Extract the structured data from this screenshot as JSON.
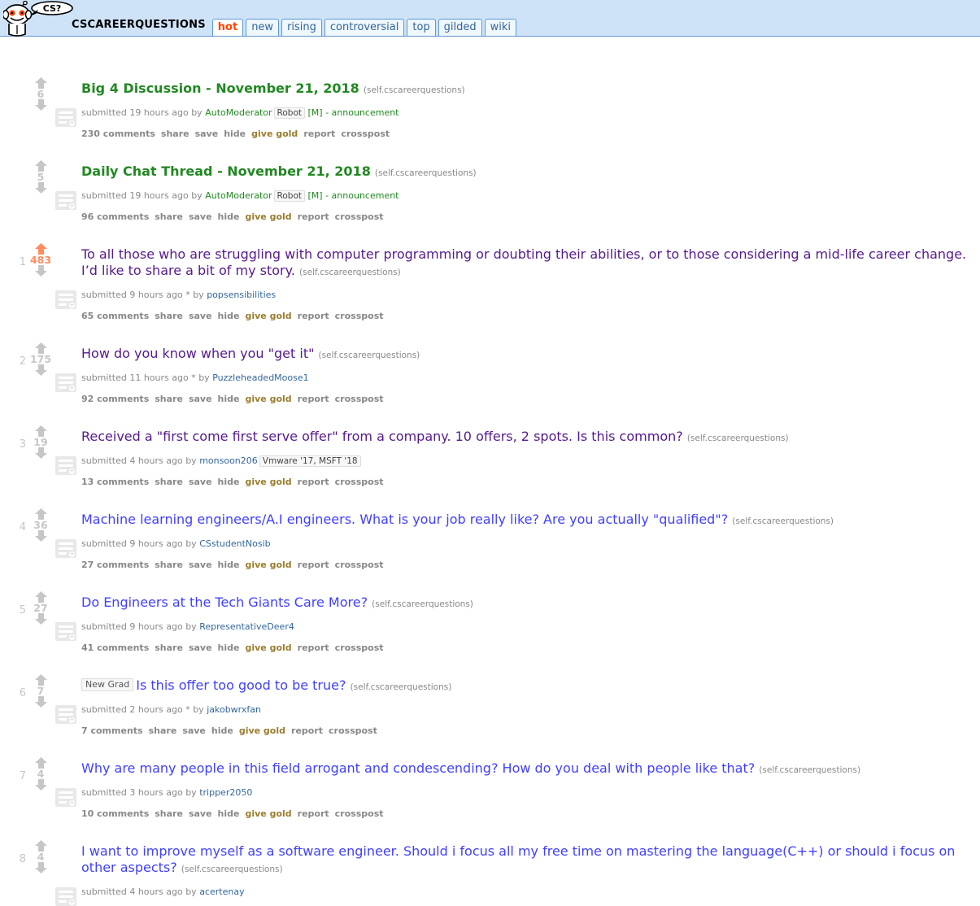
{
  "header": {
    "logo_icon": "reddit-alien-logo",
    "logo_speech_text": "CS?",
    "subreddit": "CSCAREERQUESTIONS",
    "tabs": [
      {
        "label": "hot",
        "selected": true
      },
      {
        "label": "new",
        "selected": false
      },
      {
        "label": "rising",
        "selected": false
      },
      {
        "label": "controversial",
        "selected": false
      },
      {
        "label": "top",
        "selected": false
      },
      {
        "label": "gilded",
        "selected": false
      },
      {
        "label": "wiki",
        "selected": false
      }
    ]
  },
  "colors": {
    "header_bg": "#cee3f8",
    "header_border": "#5f99cf",
    "tab_selected_text": "#ff4500",
    "tab_text": "#336699",
    "link_unvisited": "#4040ff",
    "link_visited": "#551a8b",
    "sticky_title": "#228822",
    "upvoted": "#ff8b60",
    "score_grey": "#c6c6c6",
    "meta_grey": "#888888",
    "gold_link": "#9a7d2e"
  },
  "buttons_labels": {
    "share": "share",
    "save": "save",
    "hide": "hide",
    "give_gold": "give gold",
    "report": "report",
    "crosspost": "crosspost"
  },
  "posts": [
    {
      "rank": "",
      "score": "6",
      "upvoted": false,
      "sticky": true,
      "visited": false,
      "link_flair": "",
      "title": "Big 4 Discussion - November 21, 2018",
      "domain": "(self.cscareerquestions)",
      "submitted": "submitted 19 hours ago by",
      "author": "AutoModerator",
      "author_is_mod": true,
      "user_flair": "Robot",
      "mod_bracket": "[M]",
      "flair_text": "- announcement",
      "comments": "230 comments",
      "has_thumb": true
    },
    {
      "rank": "",
      "score": "5",
      "upvoted": false,
      "sticky": true,
      "visited": false,
      "link_flair": "",
      "title": "Daily Chat Thread - November 21, 2018",
      "domain": "(self.cscareerquestions)",
      "submitted": "submitted 19 hours ago by",
      "author": "AutoModerator",
      "author_is_mod": true,
      "user_flair": "Robot",
      "mod_bracket": "[M]",
      "flair_text": "- announcement",
      "comments": "96 comments",
      "has_thumb": true
    },
    {
      "rank": "1",
      "score": "483",
      "upvoted": true,
      "sticky": false,
      "visited": true,
      "link_flair": "",
      "title": "To all those who are struggling with computer programming or doubting their abilities, or to those considering a mid-life career change. I’d like to share a bit of my story.",
      "domain": "(self.cscareerquestions)",
      "submitted": "submitted 9 hours ago * by",
      "author": "popsensibilities",
      "author_is_mod": false,
      "user_flair": "",
      "mod_bracket": "",
      "flair_text": "",
      "comments": "65 comments",
      "has_thumb": true
    },
    {
      "rank": "2",
      "score": "175",
      "upvoted": false,
      "sticky": false,
      "visited": true,
      "link_flair": "",
      "title": "How do you know when you \"get it\"",
      "domain": "(self.cscareerquestions)",
      "submitted": "submitted 11 hours ago * by",
      "author": "PuzzleheadedMoose1",
      "author_is_mod": false,
      "user_flair": "",
      "mod_bracket": "",
      "flair_text": "",
      "comments": "92 comments",
      "has_thumb": true
    },
    {
      "rank": "3",
      "score": "19",
      "upvoted": false,
      "sticky": false,
      "visited": true,
      "link_flair": "",
      "title": "Received a \"first come first serve offer\" from a company. 10 offers, 2 spots. Is this common?",
      "domain": "(self.cscareerquestions)",
      "submitted": "submitted 4 hours ago by",
      "author": "monsoon206",
      "author_is_mod": false,
      "user_flair": "Vmware '17, MSFT '18",
      "mod_bracket": "",
      "flair_text": "",
      "comments": "13 comments",
      "has_thumb": true
    },
    {
      "rank": "4",
      "score": "36",
      "upvoted": false,
      "sticky": false,
      "visited": false,
      "link_flair": "",
      "title": "Machine learning engineers/A.I engineers. What is your job really like? Are you actually \"qualified\"?",
      "domain": "(self.cscareerquestions)",
      "submitted": "submitted 9 hours ago by",
      "author": "CSstudentNosib",
      "author_is_mod": false,
      "user_flair": "",
      "mod_bracket": "",
      "flair_text": "",
      "comments": "27 comments",
      "has_thumb": true
    },
    {
      "rank": "5",
      "score": "27",
      "upvoted": false,
      "sticky": false,
      "visited": false,
      "link_flair": "",
      "title": "Do Engineers at the Tech Giants Care More?",
      "domain": "(self.cscareerquestions)",
      "submitted": "submitted 9 hours ago by",
      "author": "RepresentativeDeer4",
      "author_is_mod": false,
      "user_flair": "",
      "mod_bracket": "",
      "flair_text": "",
      "comments": "41 comments",
      "has_thumb": true
    },
    {
      "rank": "6",
      "score": "7",
      "upvoted": false,
      "sticky": false,
      "visited": false,
      "link_flair": "New Grad",
      "title": "Is this offer too good to be true?",
      "domain": "(self.cscareerquestions)",
      "submitted": "submitted 2 hours ago * by",
      "author": "jakobwrxfan",
      "author_is_mod": false,
      "user_flair": "",
      "mod_bracket": "",
      "flair_text": "",
      "comments": "7 comments",
      "has_thumb": true
    },
    {
      "rank": "7",
      "score": "4",
      "upvoted": false,
      "sticky": false,
      "visited": false,
      "link_flair": "",
      "title": "Why are many people in this field arrogant and condescending? How do you deal with people like that?",
      "domain": "(self.cscareerquestions)",
      "submitted": "submitted 3 hours ago by",
      "author": "tripper2050",
      "author_is_mod": false,
      "user_flair": "",
      "mod_bracket": "",
      "flair_text": "",
      "comments": "10 comments",
      "has_thumb": true
    },
    {
      "rank": "8",
      "score": "4",
      "upvoted": false,
      "sticky": false,
      "visited": false,
      "link_flair": "",
      "title": "I want to improve myself as a software engineer. Should i focus all my free time on mastering the language(C++) or should i focus on other aspects?",
      "domain": "(self.cscareerquestions)",
      "submitted": "submitted 4 hours ago by",
      "author": "acertenay",
      "author_is_mod": false,
      "user_flair": "",
      "mod_bracket": "",
      "flair_text": "",
      "comments": "",
      "has_thumb": true
    }
  ]
}
